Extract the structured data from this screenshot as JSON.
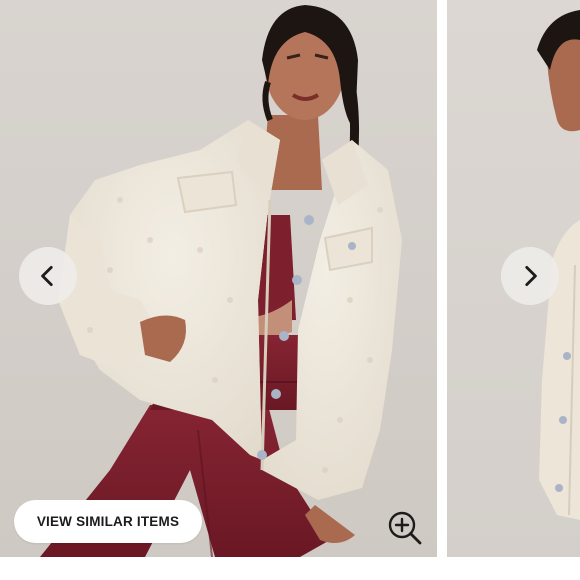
{
  "gallery": {
    "similar_label": "VIEW SIMILAR ITEMS",
    "icons": {
      "prev": "chevron-left-icon",
      "next": "chevron-right-icon",
      "zoom": "zoom-in-icon"
    },
    "colors": {
      "background": "#d6d1cc",
      "jacket": "#efe9dd",
      "outfit": "#7a1e2a",
      "button_bg": "#ffffff",
      "text": "#1c1c1c"
    }
  }
}
